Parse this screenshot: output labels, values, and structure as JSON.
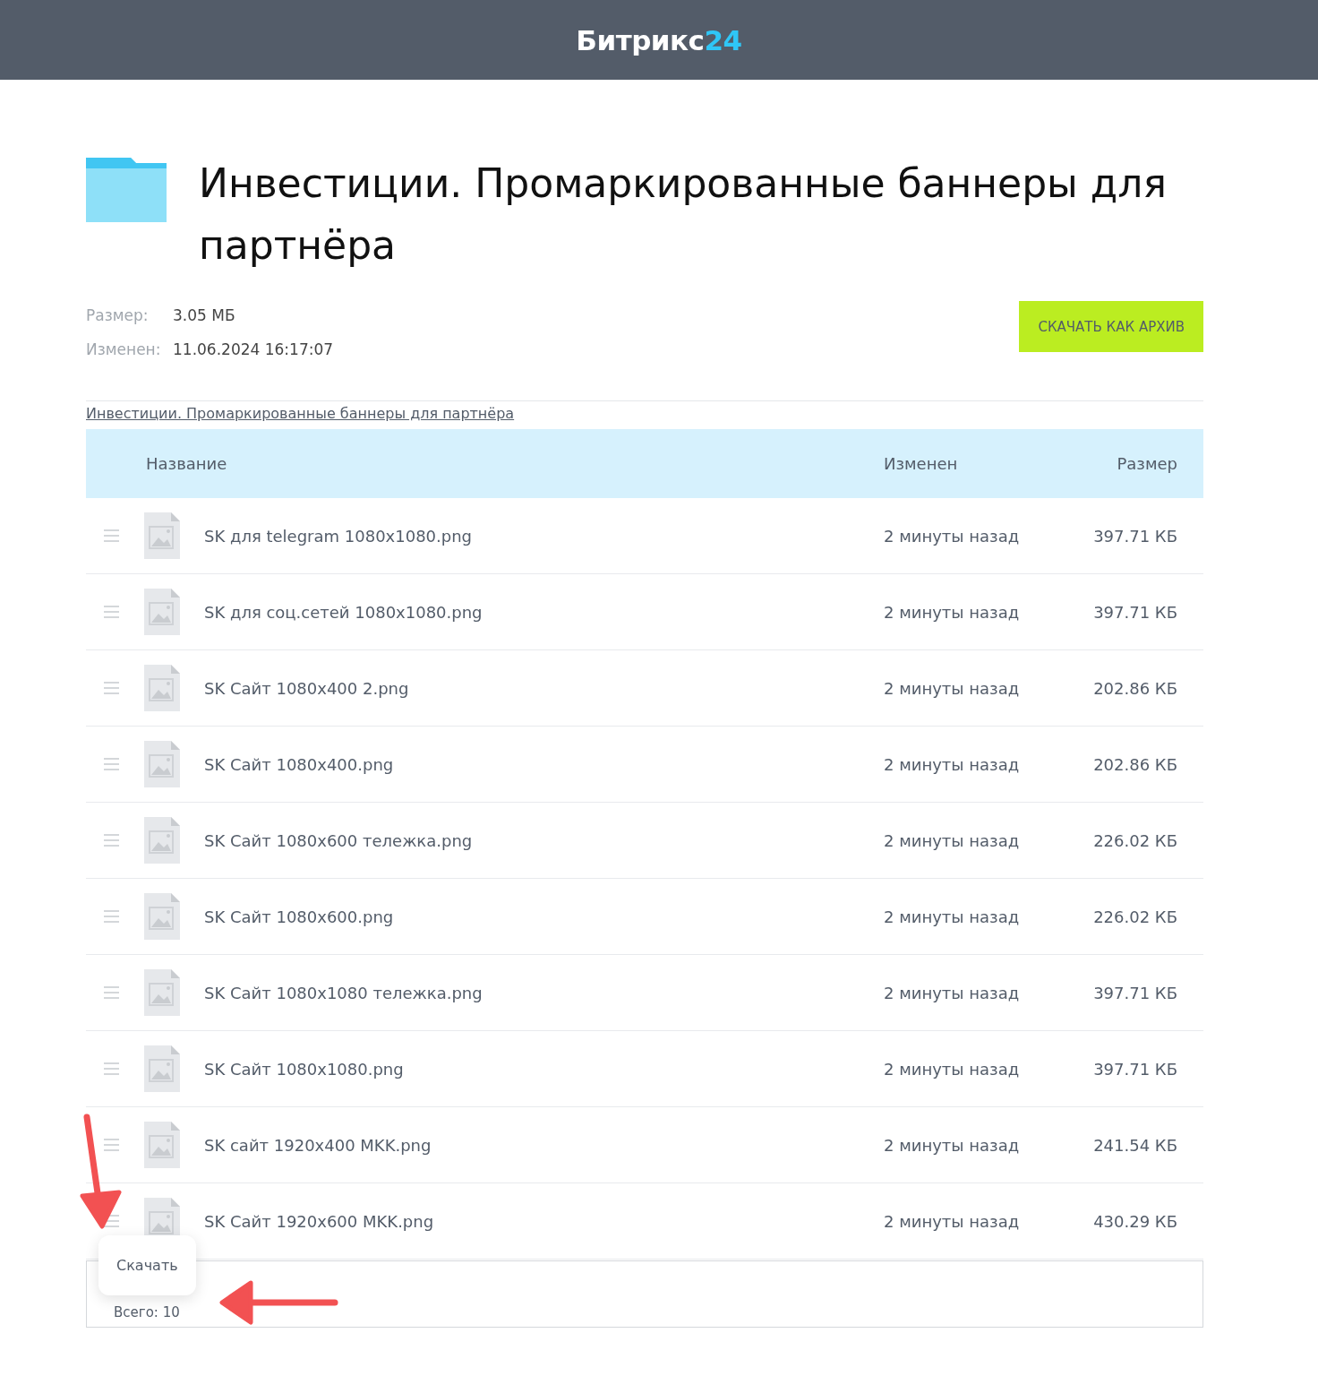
{
  "header": {
    "logo_text": "Битрикс",
    "logo_accent": "24"
  },
  "folder": {
    "title": "Инвестиции. Промаркированные баннеры для партнёра"
  },
  "meta": [
    {
      "label": "Размер:",
      "value": "3.05 МБ"
    },
    {
      "label": "Изменен:",
      "value": "11.06.2024 16:17:07"
    }
  ],
  "download_button": "СКАЧАТЬ КАК АРХИВ",
  "breadcrumb": "Инвестиции. Промаркированные баннеры для партнёра",
  "table": {
    "columns": [
      "Название",
      "Изменен",
      "Размер"
    ],
    "rows": [
      {
        "name": "SK для telegram 1080x1080.png",
        "modified": "2 минуты назад",
        "size": "397.71 КБ"
      },
      {
        "name": "SK для соц.сетей 1080x1080.png",
        "modified": "2 минуты назад",
        "size": "397.71 КБ"
      },
      {
        "name": "SK Сайт 1080x400 2.png",
        "modified": "2 минуты назад",
        "size": "202.86 КБ"
      },
      {
        "name": "SK Сайт 1080x400.png",
        "modified": "2 минуты назад",
        "size": "202.86 КБ"
      },
      {
        "name": "SK Сайт 1080x600 тележка.png",
        "modified": "2 минуты назад",
        "size": "226.02 КБ"
      },
      {
        "name": "SK Сайт 1080x600.png",
        "modified": "2 минуты назад",
        "size": "226.02 КБ"
      },
      {
        "name": "SK Сайт 1080x1080 тележка.png",
        "modified": "2 минуты назад",
        "size": "397.71 КБ"
      },
      {
        "name": "SK Сайт 1080x1080.png",
        "modified": "2 минуты назад",
        "size": "397.71 КБ"
      },
      {
        "name": "SK сайт 1920x400 MKK.png",
        "modified": "2 минуты назад",
        "size": "241.54 КБ"
      },
      {
        "name": "SK Сайт 1920x600 MKK.png",
        "modified": "2 минуты назад",
        "size": "430.29 КБ"
      }
    ],
    "footer": "Всего: 10"
  },
  "context_menu": {
    "items": [
      "Скачать"
    ]
  }
}
